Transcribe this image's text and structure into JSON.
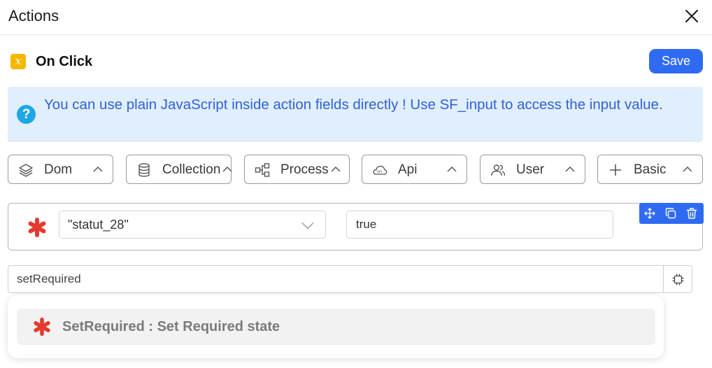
{
  "header": {
    "title": "Actions"
  },
  "event": {
    "icon_glyph": "x",
    "label": "On Click",
    "save_label": "Save"
  },
  "info": {
    "text": "You can use plain JavaScript inside action fields directly ! Use SF_input to access the input value."
  },
  "categories": [
    {
      "label": "Dom",
      "icon": "layers-icon"
    },
    {
      "label": "Collection",
      "icon": "database-icon"
    },
    {
      "label": "Process",
      "icon": "flow-icon"
    },
    {
      "label": "Api",
      "icon": "api-cloud-icon"
    },
    {
      "label": "User",
      "icon": "users-icon"
    },
    {
      "label": "Basic",
      "icon": "plus-icon"
    }
  ],
  "action": {
    "field_value": "\"statut_28\"",
    "value_input": "true"
  },
  "method": {
    "value": "setRequired"
  },
  "dropdown": {
    "option_label": "SetRequired : Set Required state"
  },
  "colors": {
    "accent": "#2f6bf2",
    "required": "#e53a2f",
    "info_bg": "#e1eefc",
    "info_text": "#2f62d8",
    "event_icon": "#f5b800"
  }
}
